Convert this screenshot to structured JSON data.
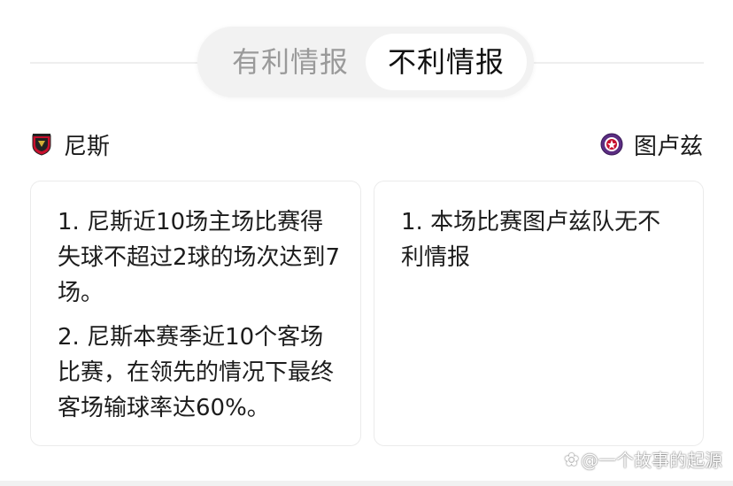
{
  "tabs": [
    {
      "label": "有利情报",
      "active": false
    },
    {
      "label": "不利情报",
      "active": true
    }
  ],
  "teams": {
    "home": {
      "name": "尼斯",
      "logo_icon": "nice-club-crest-icon"
    },
    "away": {
      "name": "图卢兹",
      "logo_icon": "toulouse-club-crest-icon"
    }
  },
  "home_items": [
    "1. 尼斯近10场主场比赛得失球不超过2球的场次达到7场。",
    "2. 尼斯本赛季近10个客场比赛，在领先的情况下最终客场输球率达60%。"
  ],
  "away_items": [
    "1. 本场比赛图卢兹队无不利情报"
  ],
  "watermark": "@一个故事的起源",
  "colors": {
    "accent_home": "#c8102e",
    "accent_away": "#5b2d82",
    "active_tab_bg": "#ffffff",
    "tab_track_bg": "#f2f2f2"
  }
}
